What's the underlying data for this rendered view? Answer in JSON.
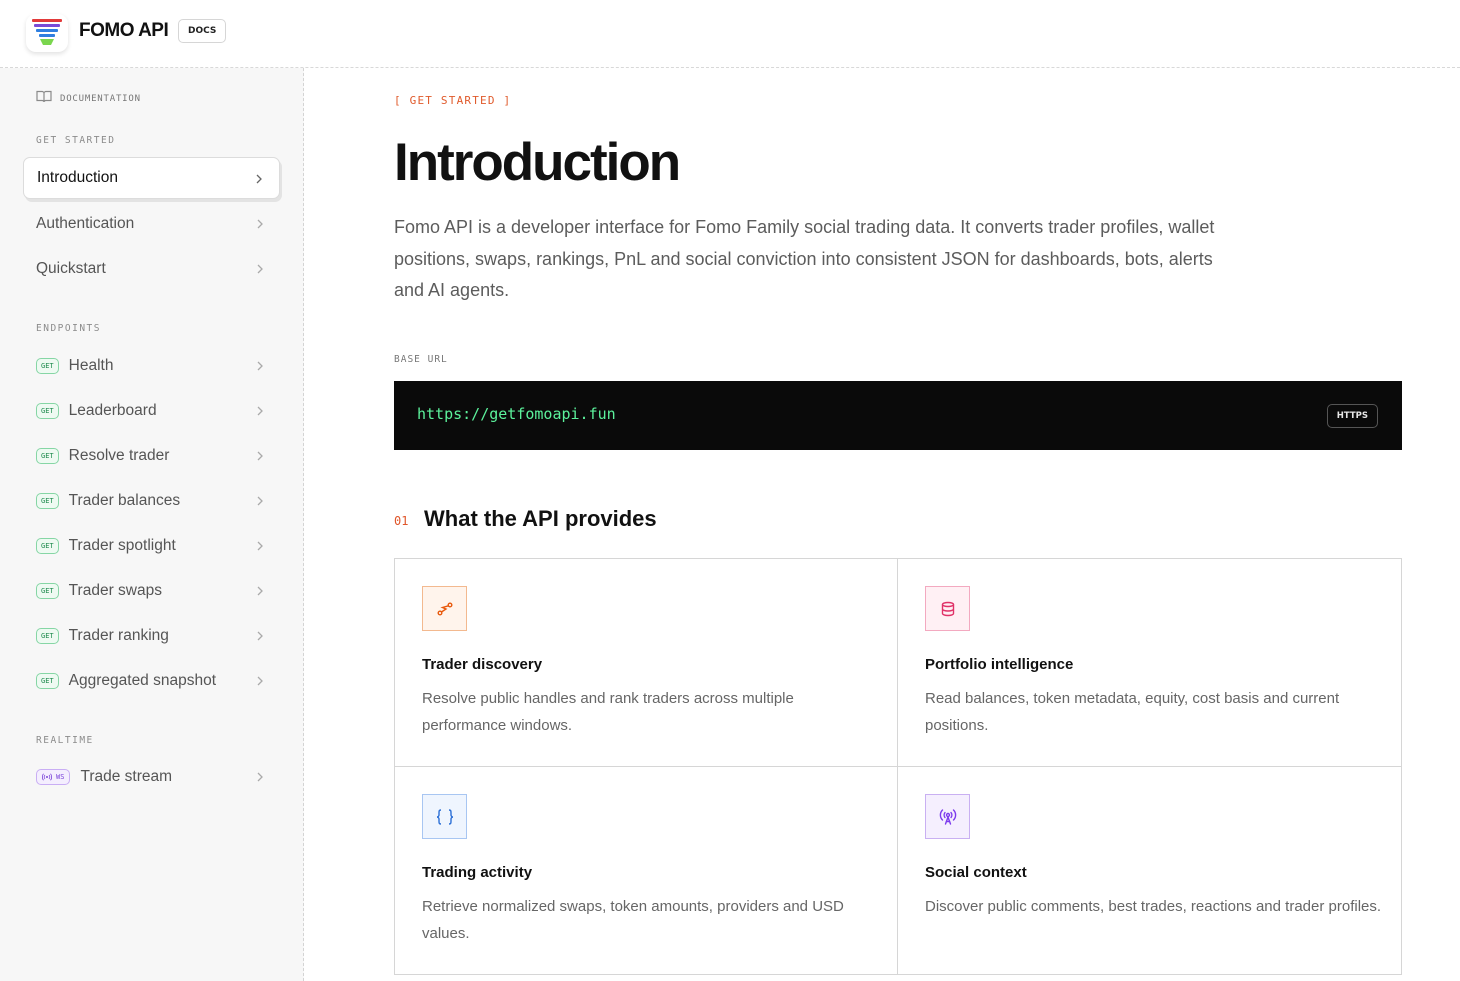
{
  "header": {
    "brand": "FOMO API",
    "docs_badge": "DOCS"
  },
  "sidebar": {
    "doc_label": "DOCUMENTATION",
    "sections": [
      {
        "title": "GET STARTED",
        "items": [
          {
            "label": "Introduction",
            "active": true
          },
          {
            "label": "Authentication"
          },
          {
            "label": "Quickstart"
          }
        ]
      },
      {
        "title": "ENDPOINTS",
        "items": [
          {
            "method": "GET",
            "label": "Health"
          },
          {
            "method": "GET",
            "label": "Leaderboard"
          },
          {
            "method": "GET",
            "label": "Resolve trader"
          },
          {
            "method": "GET",
            "label": "Trader balances"
          },
          {
            "method": "GET",
            "label": "Trader spotlight"
          },
          {
            "method": "GET",
            "label": "Trader swaps"
          },
          {
            "method": "GET",
            "label": "Trader ranking"
          },
          {
            "method": "GET",
            "label": "Aggregated snapshot"
          }
        ]
      },
      {
        "title": "REALTIME",
        "items": [
          {
            "method": "WS",
            "label": "Trade stream"
          }
        ]
      }
    ]
  },
  "main": {
    "eyebrow": "[ GET STARTED ]",
    "title": "Introduction",
    "intro": "Fomo API is a developer interface for Fomo Family social trading data. It converts trader profiles, wallet positions, swaps, rankings, PnL and social conviction into consistent JSON for dashboards, bots, alerts and AI agents.",
    "base_url_label": "BASE URL",
    "base_url": "https://getfomoapi.fun",
    "protocol_badge": "HTTPS",
    "section_number": "01",
    "section_title": "What the API provides",
    "cards": [
      {
        "icon": "route-icon",
        "title": "Trader discovery",
        "desc": "Resolve public handles and rank traders across multiple performance windows.",
        "accent": "#e8590c"
      },
      {
        "icon": "database-icon",
        "title": "Portfolio intelligence",
        "desc": "Read balances, token metadata, equity, cost basis and current positions.",
        "accent": "#e03167"
      },
      {
        "icon": "braces-icon",
        "title": "Trading activity",
        "desc": "Retrieve normalized swaps, token amounts, providers and USD values.",
        "accent": "#2b6fd6"
      },
      {
        "icon": "broadcast-icon",
        "title": "Social context",
        "desc": "Discover public comments, best trades, reactions and trader profiles.",
        "accent": "#7c3aed"
      }
    ]
  }
}
